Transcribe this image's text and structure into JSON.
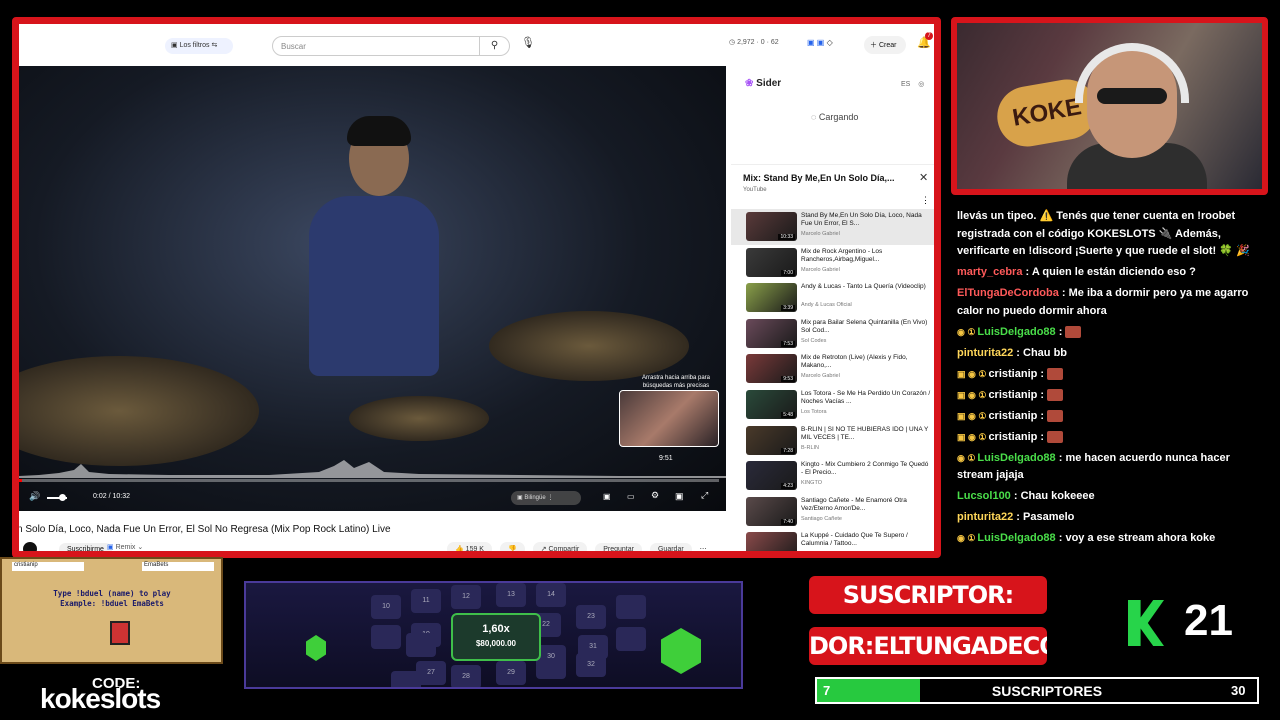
{
  "browser": {
    "filter_chip": "Los filtros",
    "search_placeholder": "Buscar",
    "stats": "2,972 · 0 · 62",
    "create_label": "Crear",
    "notif_count": "7"
  },
  "video": {
    "drag_tip": "Arrastra hacia arriba para búsquedas más precisas",
    "preview_time": "9:51",
    "current_time": "0:02 / 10:32",
    "bilingual_label": "Bilingüe",
    "progress_fraction": 0.003,
    "title": "n Solo Día, Loco, Nada Fue Un Error, El Sol No Regresa (Mix Pop Rock Latino) Live",
    "subscribe_label": "Suscribirme",
    "remix_label": "Remix",
    "actions": {
      "likes": "159 K",
      "share": "Compartir",
      "ask": "Preguntar",
      "save": "Guardar"
    }
  },
  "sider": {
    "logo": "Sider",
    "lang": "ES",
    "loading": "Cargando"
  },
  "mix": {
    "title": "Mix: Stand By Me,En Un Solo Día,...",
    "channel": "YouTube"
  },
  "playlist": [
    {
      "title": "Stand By Me,En Un Solo Día, Loco, Nada Fue Un Error, El S...",
      "channel": "Marcelo Gabriel",
      "duration": "10:33",
      "color": "#5a3a3a"
    },
    {
      "title": "Mix de Rock Argentino - Los Rancheros,Airbag,Miguel...",
      "channel": "Marcelo Gabriel",
      "duration": "7:00",
      "color": "#3a3a3a"
    },
    {
      "title": "Andy & Lucas - Tanto La Quería (Videoclip)",
      "channel": "Andy & Lucas Oficial",
      "duration": "3:39",
      "color": "#8aa04a"
    },
    {
      "title": "Mix para Bailar Selena Quintanilla (En Vivo) Sol Cod...",
      "channel": "Sol Codes",
      "duration": "7:53",
      "color": "#6a4a5a"
    },
    {
      "title": "Mix de Retroton (Live) (Alexis y Fido, Makano,...",
      "channel": "Marcelo Gabriel",
      "duration": "9:53",
      "color": "#7a3a3a"
    },
    {
      "title": "Los Totora - Se Me Ha Perdido Un Corazón / Noches Vacías ...",
      "channel": "Los Totora",
      "duration": "5:48",
      "color": "#2a4a3a"
    },
    {
      "title": "B-RLIN | SI NO TE HUBIERAS IDO | UNA Y MIL VECES | TE...",
      "channel": "B-RLIN",
      "duration": "7:28",
      "color": "#4a3a2a"
    },
    {
      "title": "Kingto - Mix Cumbiero 2 Conmigo Te Quedó - El Precio...",
      "channel": "KINGTO",
      "duration": "4:23",
      "color": "#2a2a3a"
    },
    {
      "title": "Santiago Cañete - Me Enamoré Otra Vez/Eterno Amor/De...",
      "channel": "Santiago Cañete",
      "duration": "7:40",
      "color": "#5a4a4a"
    },
    {
      "title": "La Kuppé - Cuidado Que Te Supero / Calumnia / Tattoo...",
      "channel": "",
      "duration": "",
      "color": "#8a4a4a"
    }
  ],
  "chat": [
    {
      "user": "",
      "user_color": "#fff",
      "badges": "",
      "text": "llevás un tipeo. ⚠️ Tenés que tener cuenta en !roobet registrada con el código KOKESLOTS 🔌 Además, verificarte en !discord ¡Suerte y que ruede el slot! 🍀 🎉",
      "emote": false
    },
    {
      "user": "marty_cebra",
      "user_color": "#ff5a5a",
      "badges": "",
      "text": "A quien le están diciendo eso ?",
      "emote": false
    },
    {
      "user": "ElTungaDeCordoba",
      "user_color": "#ff5a5a",
      "badges": "",
      "text": "Me iba a dormir pero ya me agarro calor no puedo dormir ahora",
      "emote": false
    },
    {
      "user": "LuisDelgado88",
      "user_color": "#4ade4a",
      "badges": "◉ ①",
      "text": "",
      "emote": true
    },
    {
      "user": "pinturita22",
      "user_color": "#ffd75a",
      "badges": "",
      "text": "Chau bb",
      "emote": false
    },
    {
      "user": "cristianip",
      "user_color": "#fff",
      "badges": "▣ ◉ ①",
      "text": "",
      "emote": true
    },
    {
      "user": "cristianip",
      "user_color": "#fff",
      "badges": "▣ ◉ ①",
      "text": "",
      "emote": true
    },
    {
      "user": "cristianip",
      "user_color": "#fff",
      "badges": "▣ ◉ ①",
      "text": "",
      "emote": true
    },
    {
      "user": "cristianip",
      "user_color": "#fff",
      "badges": "▣ ◉ ①",
      "text": "",
      "emote": true
    },
    {
      "user": "LuisDelgado88",
      "user_color": "#4ade4a",
      "badges": "◉ ①",
      "text": "me hacen acuerdo nunca hacer stream jajaja",
      "emote": false
    },
    {
      "user": "Lucsol100",
      "user_color": "#4ade4a",
      "badges": "",
      "text": "Chau kokeeee",
      "emote": false
    },
    {
      "user": "pinturita22",
      "user_color": "#ffd75a",
      "badges": "",
      "text": "Pasamelo",
      "emote": false
    },
    {
      "user": "LuisDelgado88",
      "user_color": "#4ade4a",
      "badges": "◉ ①",
      "text": "voy a ese stream ahora koke",
      "emote": false
    }
  ],
  "webcam": {
    "sign_text": "KOKE"
  },
  "game": {
    "player_left": "cristianip",
    "player_right": "EmaBets",
    "instruction": "Type !bduel (name) to play",
    "example": "Example: !bduel EmaBets"
  },
  "branding": {
    "code_label": "CODE:",
    "brand": "kokeslots"
  },
  "board": {
    "multiplier": "1,60x",
    "prize": "$80,000.00",
    "tiles": [
      "10",
      "11",
      "12",
      "13",
      "14",
      "21",
      "22",
      "23",
      "24",
      "25",
      "26",
      "27",
      "28",
      "29",
      "30",
      "31",
      "32",
      "19",
      "20",
      "18"
    ]
  },
  "subscriber": {
    "banner_top": "SUSCRIPTOR:",
    "banner_bottom": "DOR:ELTUNGADECOI",
    "count": "21",
    "goal_current": "7",
    "goal_label": "SUSCRIPTORES",
    "goal_target": "30",
    "goal_fraction": 0.233,
    "accent": "#d7141b",
    "green": "#27d44a"
  }
}
